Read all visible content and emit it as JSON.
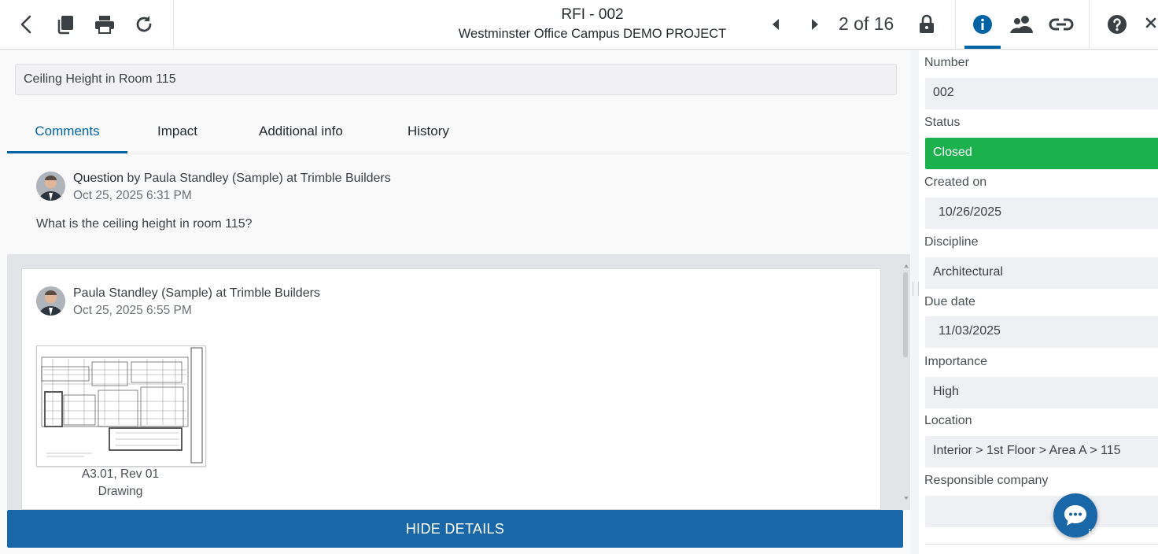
{
  "toolbar": {
    "title": "RFI - 002",
    "subtitle": "Westminster Office Campus DEMO PROJECT",
    "pager": "2 of 16",
    "icons": [
      "back-icon",
      "copy-icon",
      "print-icon",
      "refresh-icon",
      "previous-icon",
      "next-icon",
      "lock-icon",
      "info-icon",
      "people-icon",
      "link-icon",
      "help-icon",
      "close-icon"
    ]
  },
  "subject": "Ceiling Height in Room 115",
  "tabs": [
    "Comments",
    "Impact",
    "Additional info",
    "History"
  ],
  "active_tab": "Comments",
  "question": {
    "type": "Question",
    "author": " by Paula Standley (Sample) at Trimble Builders",
    "date": "Oct 25, 2025 6:31 PM",
    "text": "What is the ceiling height in room 115?"
  },
  "reply": {
    "author": "Paula Standley (Sample) at Trimble Builders",
    "date": "Oct 25, 2025 6:55 PM",
    "attachment_name": "A3.01, Rev 01",
    "attachment_type": "Drawing"
  },
  "hide_details_label": "HIDE DETAILS",
  "properties": {
    "number_label": "Number",
    "number": "002",
    "status_label": "Status",
    "status": "Closed",
    "created_label": "Created on",
    "created": "10/26/2025",
    "discipline_label": "Discipline",
    "discipline": "Architectural",
    "due_label": "Due date",
    "due": "11/03/2025",
    "importance_label": "Importance",
    "importance": "High",
    "location_label": "Location",
    "location": "Interior > 1st Floor > Area A > 115",
    "responsible_label": "Responsible company",
    "responsible": ""
  },
  "colors": {
    "accent": "#0063a3",
    "status_closed": "#1bb14c",
    "button": "#1a67a8"
  }
}
